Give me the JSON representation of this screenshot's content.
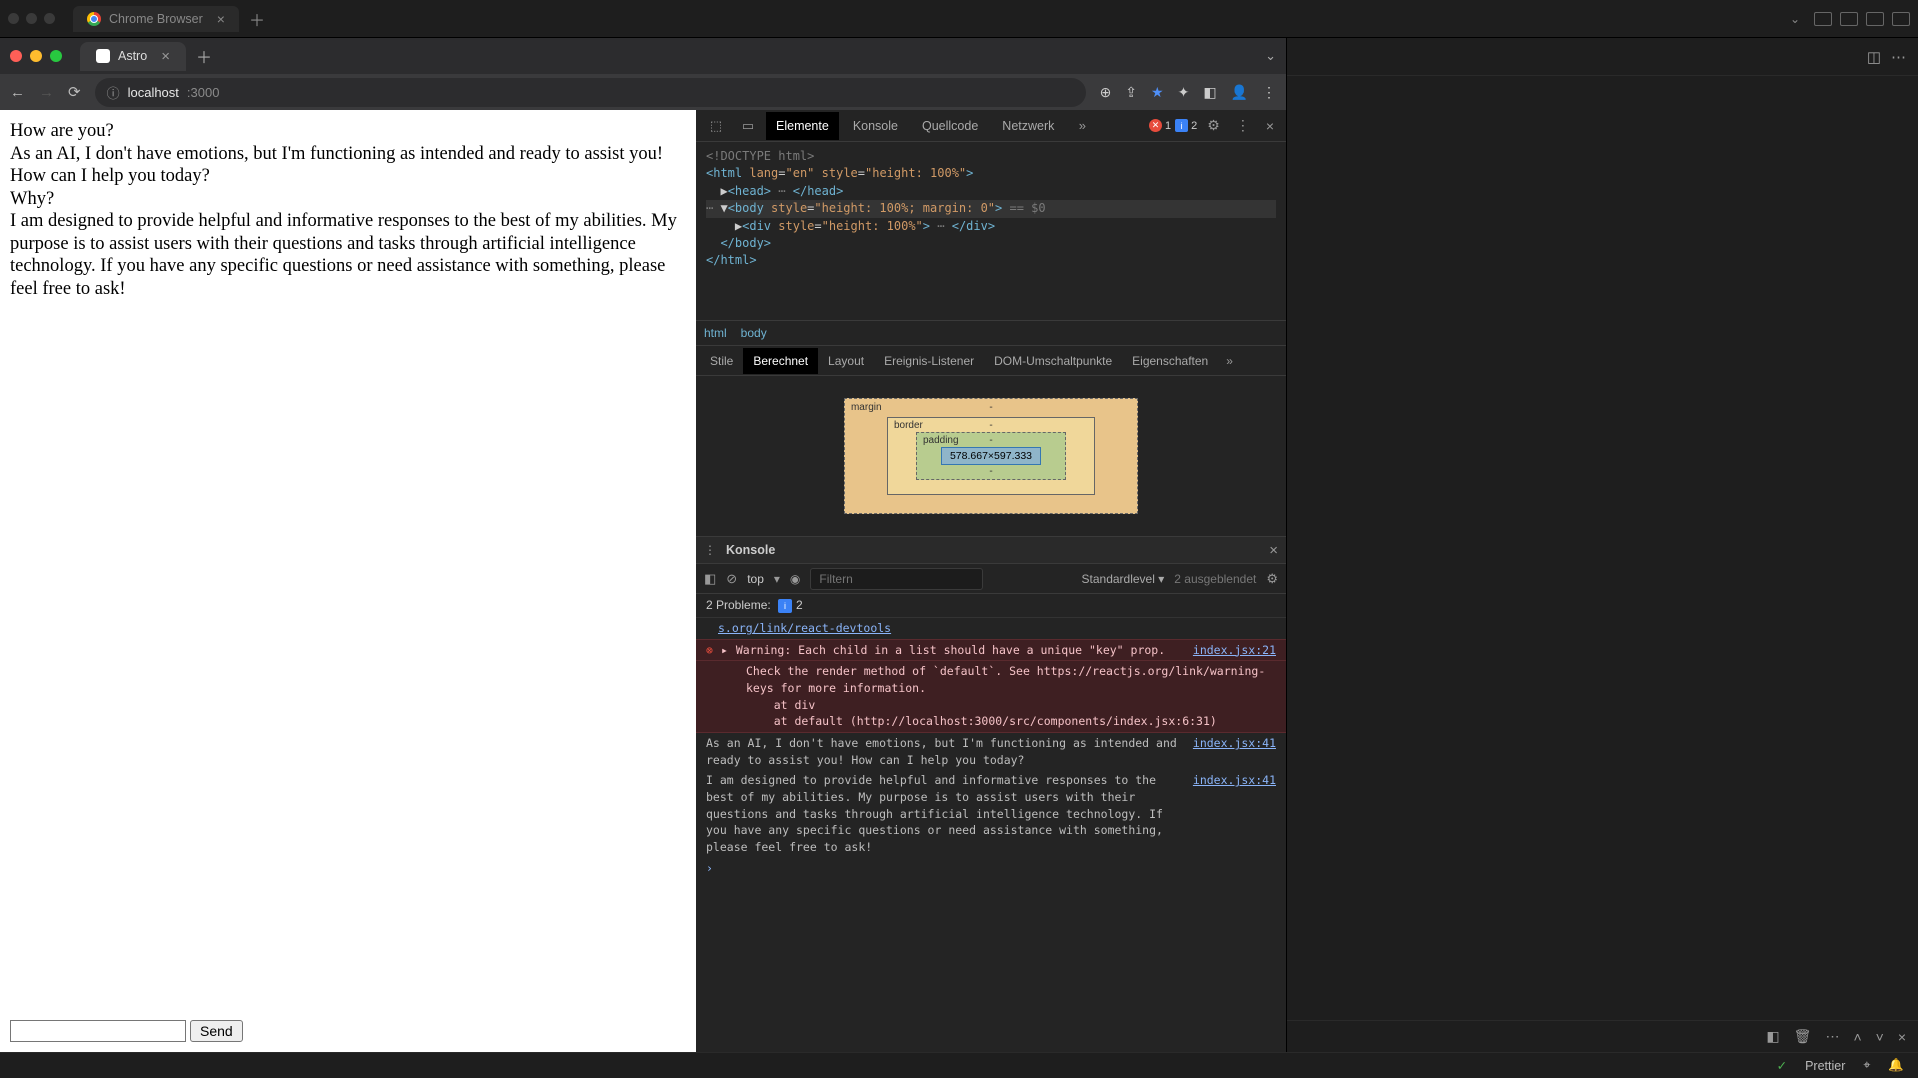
{
  "outer": {
    "tab_label": "Chrome Browser"
  },
  "chrome": {
    "tab_label": "Astro",
    "url_host": "localhost",
    "url_path": ":3000"
  },
  "chat": {
    "messages": [
      "How are you?",
      "As an AI, I don't have emotions, but I'm functioning as intended and ready to assist you! How can I help you today?",
      "Why?",
      "I am designed to provide helpful and informative responses to the best of my abilities. My purpose is to assist users with their questions and tasks through artificial intelligence technology. If you have any specific questions or need assistance with something, please feel free to ask!"
    ],
    "send_label": "Send"
  },
  "devtools": {
    "tabs": [
      "Elemente",
      "Konsole",
      "Quellcode",
      "Netzwerk"
    ],
    "active_tab": "Elemente",
    "error_count": "1",
    "info_count": "2",
    "dom_lines": [
      "<!DOCTYPE html>",
      "<html lang=\"en\" style=\"height: 100%\">",
      " ▶<head> ⋯ </head>",
      "⋯ ▼<body style=\"height: 100%; margin: 0\"> == $0",
      "   ▶<div style=\"height: 100%\"> ⋯ </div>",
      "  </body>",
      "</html>"
    ],
    "crumbs": [
      "html",
      "body"
    ],
    "subtabs": [
      "Stile",
      "Berechnet",
      "Layout",
      "Ereignis-Listener",
      "DOM-Umschaltpunkte",
      "Eigenschaften"
    ],
    "active_subtab": "Berechnet",
    "box": {
      "margin": "margin",
      "border": "border",
      "padding": "padding",
      "dims": "578.667×597.333"
    },
    "console_title": "Konsole",
    "filter_context": "top",
    "filter_placeholder": "Filtern",
    "level": "Standardlevel",
    "hidden": "2 ausgeblendet",
    "problems_label": "2 Probleme:",
    "problems_count": "2",
    "link_top": "s.org/link/react-devtools",
    "warn_text": "Warning: Each child in a list should have a unique \"key\" prop.",
    "warn_src": "index.jsx:21",
    "warn_body": "Check the render method of `default`. See https://reactjs.org/link/warning-keys for more information.\n    at div\n    at default (http://localhost:3000/src/components/index.jsx:6:31)",
    "log1": "As an AI, I don't have emotions, but I'm functioning as intended and ready to assist you! How can I help you today?",
    "log1_src": "index.jsx:41",
    "log2": "I am designed to provide helpful and informative responses to the best of my abilities. My purpose is to assist users with their questions and tasks through artificial intelligence technology. If you have any specific questions or need assistance with something, please feel free to ask!",
    "log2_src": "index.jsx:41"
  },
  "status": {
    "prettier": "Prettier"
  }
}
